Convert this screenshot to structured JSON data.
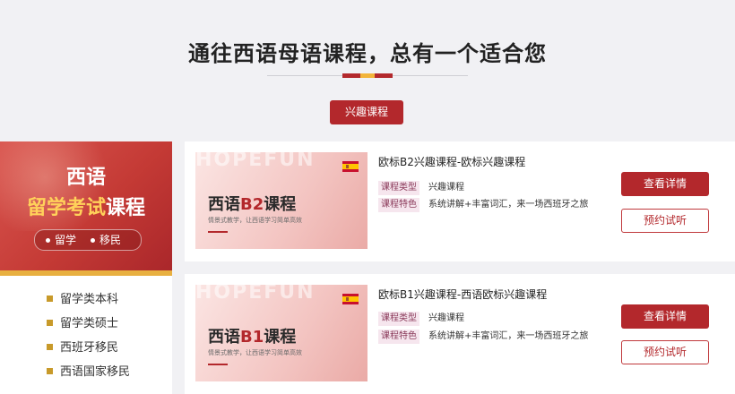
{
  "section": {
    "title": "通往西语母语课程，总有一个适合您",
    "tab_active": "兴趣课程"
  },
  "banner": {
    "line1": "西语",
    "line2_highlight": "留学考试",
    "line2_rest": "课程",
    "tag1": "留学",
    "tag2": "移民"
  },
  "menu": {
    "items": [
      {
        "label": "留学类本科"
      },
      {
        "label": "留学类硕士"
      },
      {
        "label": "西班牙移民"
      },
      {
        "label": "西语国家移民"
      }
    ]
  },
  "courses": [
    {
      "thumb_watermark": "HOPEFUN",
      "thumb_title_prefix": "西语",
      "thumb_level": "B2",
      "thumb_title_suffix": "课程",
      "thumb_subtitle": "情景式教学，让西语学习简单高效",
      "title": "欧标B2兴趣课程-欧标兴趣课程",
      "type_label": "课程类型",
      "type_value": "兴趣课程",
      "feature_label": "课程特色",
      "feature_value": "系统讲解+丰富词汇，来一场西班牙之旅",
      "detail_button": "查看详情",
      "trial_button": "预约试听"
    },
    {
      "thumb_watermark": "HOPEFUN",
      "thumb_title_prefix": "西语",
      "thumb_level": "B1",
      "thumb_title_suffix": "课程",
      "thumb_subtitle": "情景式教学，让西语学习简单高效",
      "title": "欧标B1兴趣课程-西语欧标兴趣课程",
      "type_label": "课程类型",
      "type_value": "兴趣课程",
      "feature_label": "课程特色",
      "feature_value": "系统讲解+丰富词汇，来一场西班牙之旅",
      "detail_button": "查看详情",
      "trial_button": "预约试听"
    }
  ],
  "colors": {
    "accent": "#b3282c",
    "gold": "#e8b040",
    "badge_bg": "#f6e6ee"
  },
  "icons": {
    "flag": "spain-flag-icon",
    "menu_bullet": "square-bullet-icon"
  }
}
